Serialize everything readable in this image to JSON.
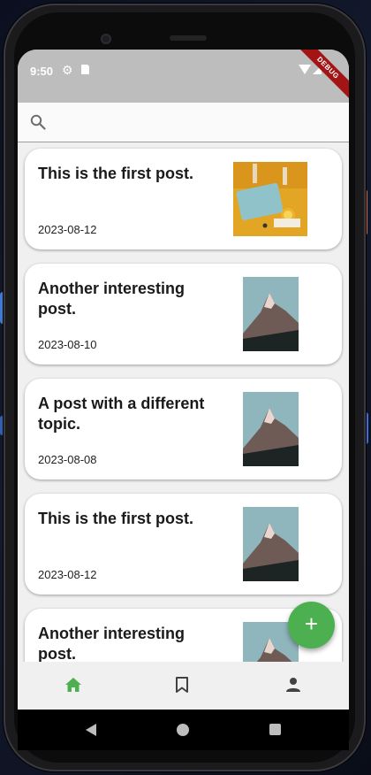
{
  "status_bar": {
    "time": "9:50",
    "debug_label": "DEBUG"
  },
  "search": {
    "placeholder": ""
  },
  "posts": [
    {
      "title": "This is the first post.",
      "date": "2023-08-12",
      "thumbnail": "food-table-photo"
    },
    {
      "title": "Another interesting post.",
      "date": "2023-08-10",
      "thumbnail": "mountain-photo"
    },
    {
      "title": "A post with a different topic.",
      "date": "2023-08-08",
      "thumbnail": "mountain-photo"
    },
    {
      "title": "This is the first post.",
      "date": "2023-08-12",
      "thumbnail": "mountain-photo"
    },
    {
      "title": "Another interesting post.",
      "date": "",
      "thumbnail": "mountain-photo"
    }
  ],
  "fab": {
    "icon": "plus-icon",
    "color": "#4caf50"
  },
  "bottom_nav": {
    "items": [
      {
        "name": "home",
        "icon": "home-icon",
        "active": true
      },
      {
        "name": "bookmarks",
        "icon": "bookmark-icon",
        "active": false
      },
      {
        "name": "profile",
        "icon": "person-icon",
        "active": false
      }
    ],
    "active_color": "#4caf50",
    "inactive_color": "#424242"
  },
  "theme": {
    "card_background": "#ffffff",
    "screen_background": "#f0f0f0",
    "status_bar_color": "#bdbdbd"
  }
}
